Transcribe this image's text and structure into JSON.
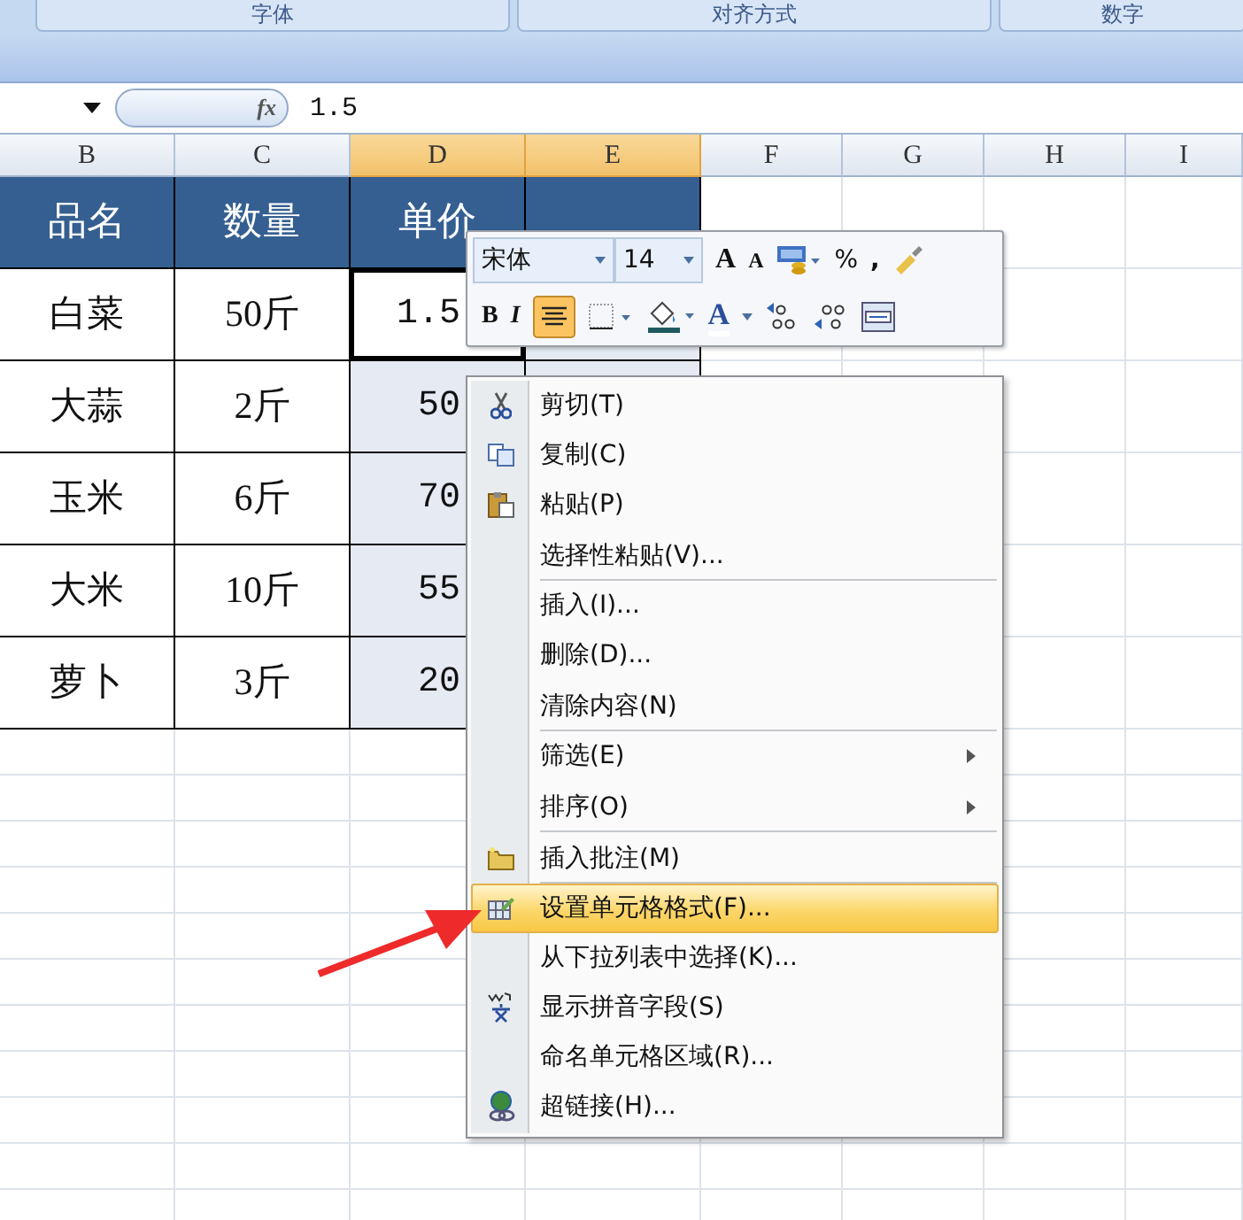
{
  "ribbon_groups": [
    "字体",
    "对齐方式",
    "数字"
  ],
  "formula_bar": {
    "function_label": "fx",
    "value": "1.5"
  },
  "columns": [
    {
      "letter": "B",
      "selected": false
    },
    {
      "letter": "C",
      "selected": false
    },
    {
      "letter": "D",
      "selected": true
    },
    {
      "letter": "E",
      "selected": true
    },
    {
      "letter": "F",
      "selected": false
    },
    {
      "letter": "G",
      "selected": false
    },
    {
      "letter": "H",
      "selected": false
    },
    {
      "letter": "I",
      "selected": false
    }
  ],
  "table": {
    "header": [
      "品名",
      "数量",
      "单价"
    ],
    "rows": [
      {
        "cells": [
          {
            "text": "白菜",
            "selected": false
          },
          {
            "text": "50斤",
            "selected": false
          },
          {
            "text": "1.5",
            "selected": false
          }
        ]
      },
      {
        "cells": [
          {
            "text": "大蒜",
            "selected": false
          },
          {
            "text": "2斤",
            "selected": false
          },
          {
            "text": "50",
            "selected": true
          }
        ]
      },
      {
        "cells": [
          {
            "text": "玉米",
            "selected": false
          },
          {
            "text": "6斤",
            "selected": false
          },
          {
            "text": "70",
            "selected": true
          }
        ]
      },
      {
        "cells": [
          {
            "text": "大米",
            "selected": false
          },
          {
            "text": "10斤",
            "selected": false
          },
          {
            "text": "55",
            "selected": true
          }
        ]
      },
      {
        "cells": [
          {
            "text": "萝卜",
            "selected": false
          },
          {
            "text": "3斤",
            "selected": false
          },
          {
            "text": "20",
            "selected": true
          }
        ]
      }
    ]
  },
  "mini_toolbar": {
    "font": "宋体",
    "size": "14",
    "grow": "A",
    "shrink": "A",
    "percent": "%",
    "comma": ",",
    "bold": "B",
    "italic": "I",
    "font_color": "A",
    "align_center_on": true
  },
  "context_menu": [
    {
      "label": "剪切(T)",
      "submenu": false,
      "selected": false,
      "separator_after": false
    },
    {
      "label": "复制(C)",
      "submenu": false,
      "selected": false,
      "separator_after": false
    },
    {
      "label": "粘贴(P)",
      "submenu": false,
      "selected": false,
      "separator_after": false
    },
    {
      "label": "选择性粘贴(V)...",
      "submenu": false,
      "selected": false,
      "separator_after": true
    },
    {
      "label": "插入(I)...",
      "submenu": false,
      "selected": false,
      "separator_after": false
    },
    {
      "label": "删除(D)...",
      "submenu": false,
      "selected": false,
      "separator_after": false
    },
    {
      "label": "清除内容(N)",
      "submenu": false,
      "selected": false,
      "separator_after": true
    },
    {
      "label": "筛选(E)",
      "submenu": true,
      "selected": false,
      "separator_after": false
    },
    {
      "label": "排序(O)",
      "submenu": true,
      "selected": false,
      "separator_after": true
    },
    {
      "label": "插入批注(M)",
      "submenu": false,
      "selected": false,
      "separator_after": true
    },
    {
      "label": "设置单元格格式(F)...",
      "submenu": false,
      "selected": true,
      "separator_after": false
    },
    {
      "label": "从下拉列表中选择(K)...",
      "submenu": false,
      "selected": false,
      "separator_after": false
    },
    {
      "label": "显示拼音字段(S)",
      "submenu": false,
      "selected": false,
      "separator_after": false
    },
    {
      "label": "命名单元格区域(R)...",
      "submenu": false,
      "selected": false,
      "separator_after": false
    },
    {
      "label": "超链接(H)...",
      "submenu": false,
      "selected": false,
      "separator_after": false
    }
  ]
}
